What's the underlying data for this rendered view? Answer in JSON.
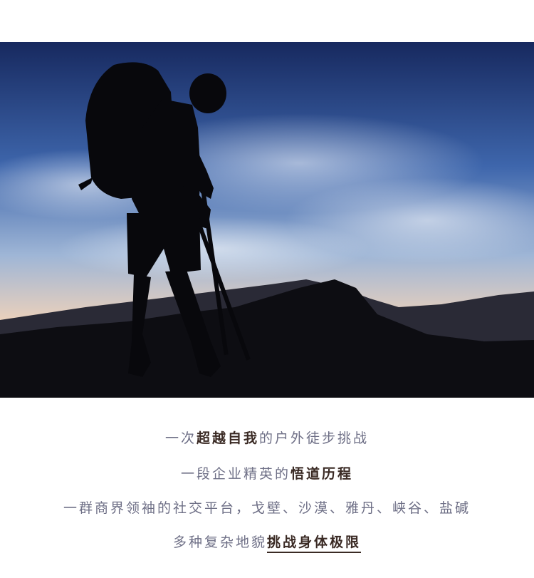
{
  "photo": {
    "subject": "hiker-silhouette",
    "colors": {
      "sky_top": "#1b2f6e",
      "sky_mid": "#4a73b8",
      "horizon": "#f2c9a6",
      "silhouette": "#0b0b10"
    }
  },
  "caption": {
    "line1": {
      "pre": "一次",
      "highlight": "超越自我",
      "post": "的户外徒步挑战"
    },
    "line2": {
      "pre": "一段企业精英的",
      "highlight": "悟道历程"
    },
    "line3": {
      "text": "一群商界领袖的社交平台，戈壁、沙漠、雅丹、峡谷、盐碱"
    },
    "line4": {
      "pre": "多种复杂地貌",
      "highlight": "挑战身体极限"
    }
  }
}
